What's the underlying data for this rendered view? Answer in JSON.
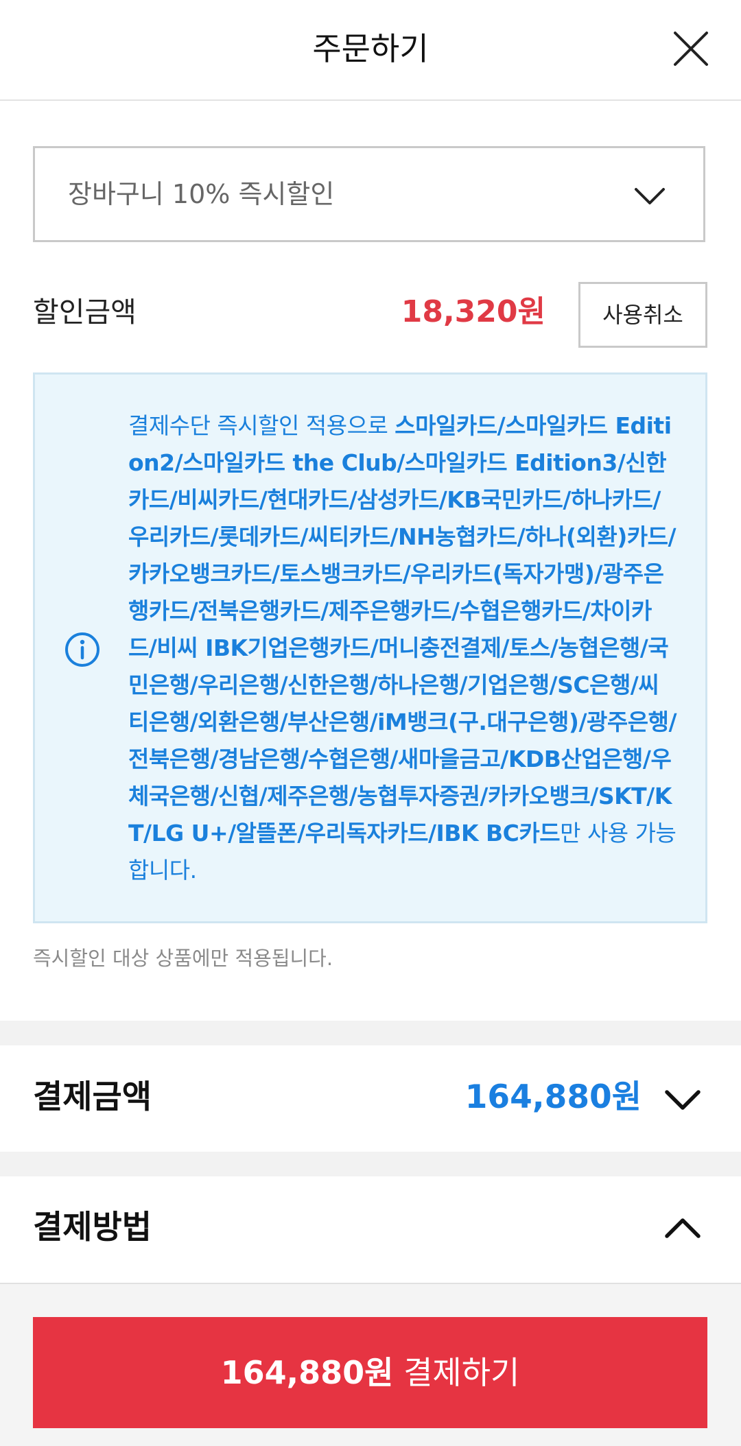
{
  "header": {
    "title": "주문하기",
    "close_icon": "close-icon"
  },
  "discount": {
    "selected_option": "장바구니 10% 즉시할인",
    "label": "할인금액",
    "amount": "18,320원",
    "cancel_label": "사용취소"
  },
  "info": {
    "icon": "info-icon",
    "prefix": "결제수단 즉시할인 적용으로 ",
    "methods": "스마일카드/스마일카드 Edition2/스마일카드 the Club/스마일카드 Edition3/신한카드/비씨카드/현대카드/삼성카드/KB국민카드/하나카드/우리카드/롯데카드/씨티카드/NH농협카드/하나(외환)카드/카카오뱅크카드/토스뱅크카드/우리카드(독자가맹)/광주은행카드/전북은행카드/제주은행카드/수협은행카드/차이카드/비씨 IBK기업은행카드/머니충전결제/토스/농협은행/국민은행/우리은행/신한은행/하나은행/기업은행/SC은행/씨티은행/외환은행/부산은행/iM뱅크(구.대구은행)/광주은행/전북은행/경남은행/수협은행/새마을금고/KDB산업은행/우체국은행/신협/제주은행/농협투자증권/카카오뱅크/SKT/KT/LG U+/알뜰폰/우리독자카드/IBK BC카드",
    "suffix": "만 사용 가능합니다."
  },
  "note": "즉시할인 대상 상품에만 적용됩니다.",
  "payment_amount": {
    "label": "결제금액",
    "value": "164,880원"
  },
  "payment_method": {
    "label": "결제방법"
  },
  "pay_button": {
    "amount": "164,880원",
    "label": " 결제하기"
  },
  "colors": {
    "accent_red": "#e63442",
    "price_red": "#e03a45",
    "price_blue": "#1a7fe0",
    "info_blue": "#1a80dc",
    "info_bg": "#eaf6fc"
  }
}
